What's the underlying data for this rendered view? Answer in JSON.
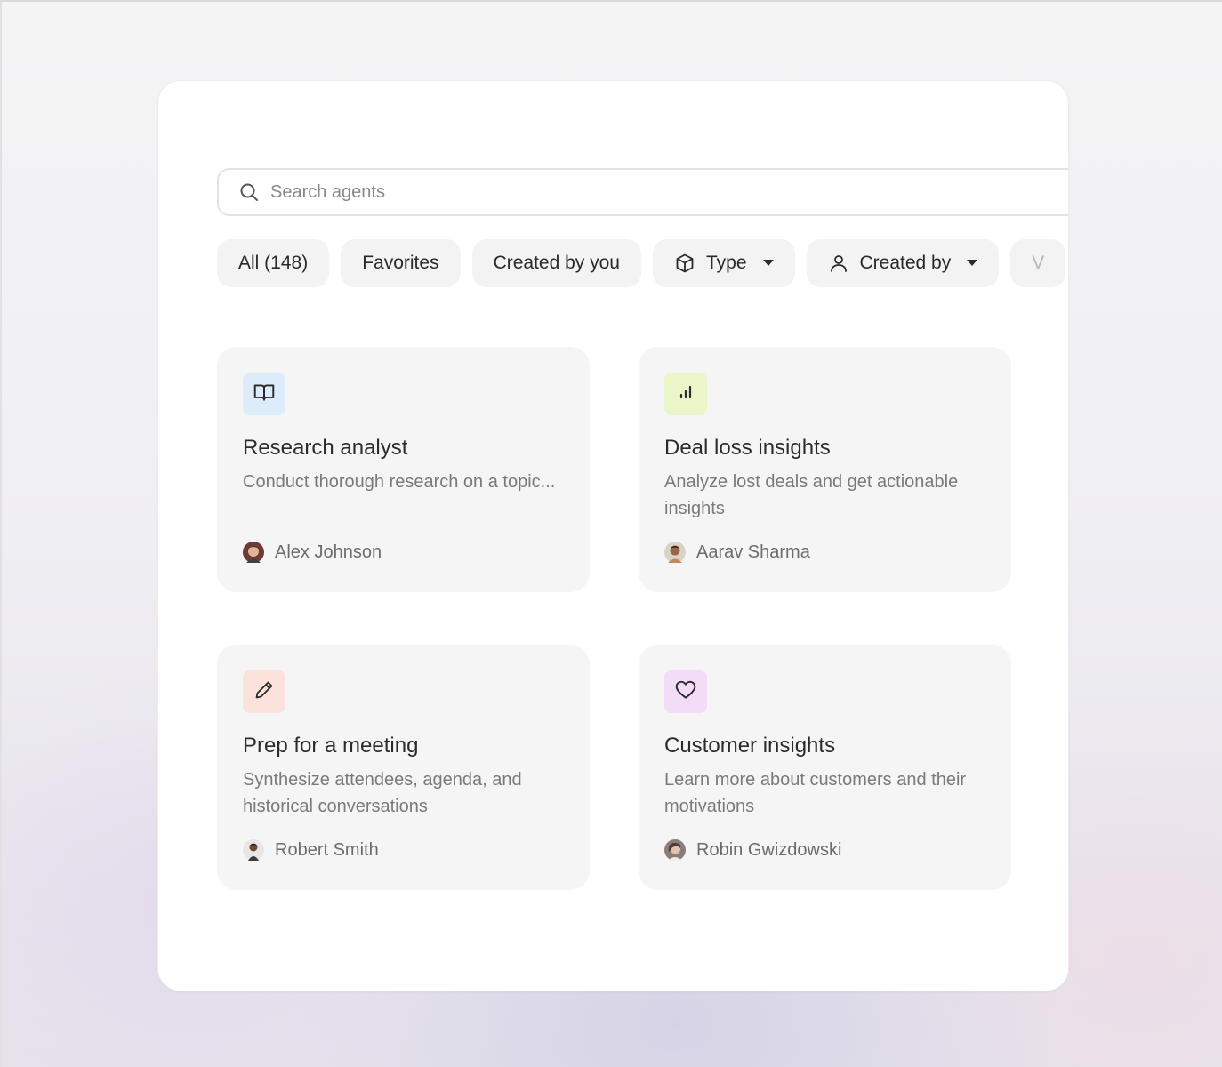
{
  "search": {
    "placeholder": "Search agents"
  },
  "filters": {
    "all": "All (148)",
    "favorites": "Favorites",
    "created_by_you": "Created by you",
    "type": "Type",
    "created_by": "Created by",
    "more": "V"
  },
  "cards": [
    {
      "icon": "book-open-icon",
      "icon_bg": "#dcecfb",
      "title": "Research analyst",
      "description": "Conduct thorough research on a topic...",
      "author": "Alex Johnson"
    },
    {
      "icon": "bar-chart-icon",
      "icon_bg": "#eaf5c8",
      "title": "Deal loss insights",
      "description": "Analyze lost deals and get actionable insights",
      "author": "Aarav Sharma"
    },
    {
      "icon": "pencil-icon",
      "icon_bg": "#fbe3dc",
      "title": "Prep for a meeting",
      "description": "Synthesize attendees, agenda, and historical conversations",
      "author": "Robert Smith"
    },
    {
      "icon": "heart-icon",
      "icon_bg": "#f2dcf8",
      "title": "Customer insights",
      "description": "Learn more about customers and their motivations",
      "author": "Robin Gwizdowski"
    }
  ]
}
